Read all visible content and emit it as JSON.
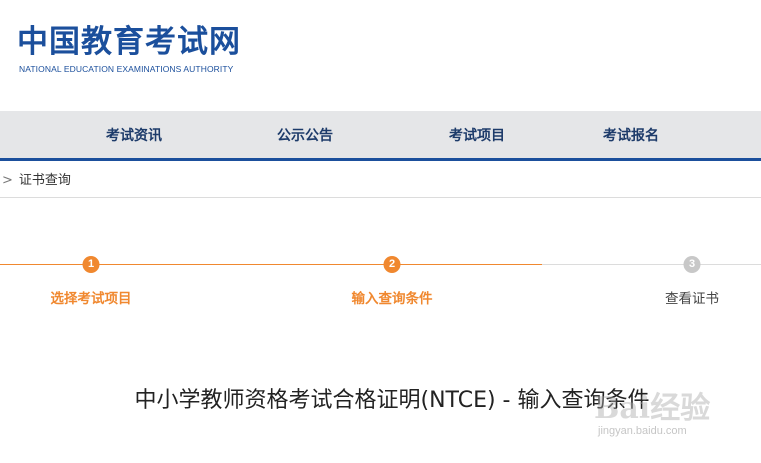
{
  "header": {
    "logo_cn": "中国教育考试网",
    "logo_en": "NATIONAL EDUCATION EXAMINATIONS AUTHORITY"
  },
  "nav": {
    "items": [
      {
        "label": "考试资讯"
      },
      {
        "label": "公示公告"
      },
      {
        "label": "考试项目"
      },
      {
        "label": "考试报名"
      }
    ]
  },
  "breadcrumb": {
    "separator": ">",
    "current": "证书查询"
  },
  "steps": [
    {
      "number": "1",
      "label": "选择考试项目",
      "state": "done"
    },
    {
      "number": "2",
      "label": "输入查询条件",
      "state": "done"
    },
    {
      "number": "3",
      "label": "查看证书",
      "state": "todo"
    }
  ],
  "page_title": "中小学教师资格考试合格证明(NTCE) - 输入查询条件",
  "watermark": {
    "text": "Bai经验",
    "url": "jingyan.baidu.com"
  },
  "colors": {
    "brand_blue": "#1b4f9c",
    "accent_orange": "#f0882f",
    "nav_bg": "#e5e6e8",
    "inactive_gray": "#c8c8c8"
  }
}
